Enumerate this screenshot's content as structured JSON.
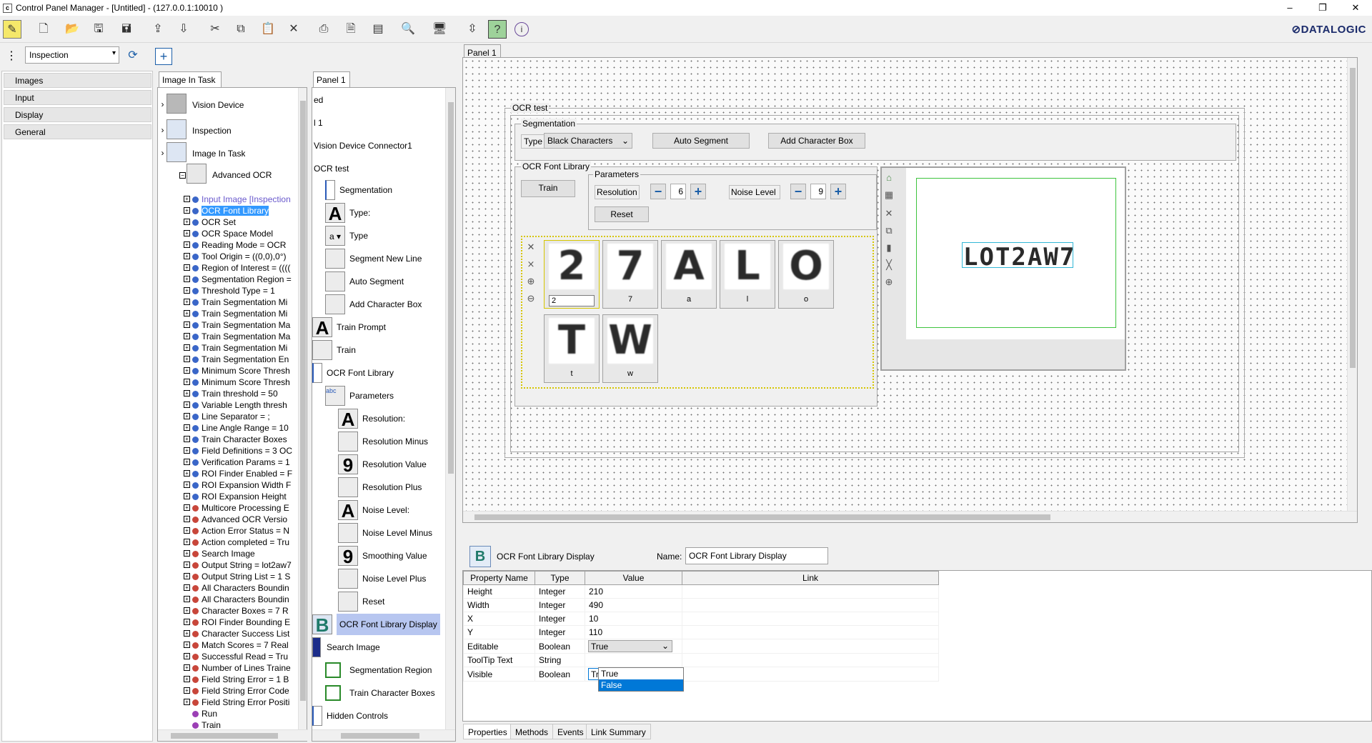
{
  "window": {
    "title": "Control Panel Manager - [Untitled] - (127.0.0.1:10010 )",
    "app_icon": "c",
    "min": "–",
    "max": "❐",
    "close": "✕"
  },
  "brand": {
    "logo": "⊘DATALOGIC"
  },
  "toolbar": {
    "inspection_value": "Inspection"
  },
  "nav": {
    "items": [
      "Images",
      "Input",
      "Display",
      "General"
    ]
  },
  "tree_panel": {
    "tab": "Image In Task",
    "top_items": [
      "Vision Device",
      "Inspection",
      "Image In Task",
      "Advanced OCR"
    ],
    "sub_items": [
      {
        "label": "Input Image [Inspection",
        "color": "#3a66c8",
        "text_color": "#6a5acd"
      },
      {
        "label": "OCR Font Library",
        "color": "#3a66c8",
        "selected": true
      },
      {
        "label": "OCR Set",
        "color": "#3a66c8"
      },
      {
        "label": "OCR Space Model",
        "color": "#3a66c8"
      },
      {
        "label": "Reading Mode = OCR",
        "color": "#3a66c8"
      },
      {
        "label": "Tool Origin = ((0,0),0°)",
        "color": "#3a66c8"
      },
      {
        "label": "Region of Interest = ((((",
        "color": "#3a66c8"
      },
      {
        "label": "Segmentation Region =",
        "color": "#3a66c8"
      },
      {
        "label": "Threshold Type = 1",
        "color": "#3a66c8"
      },
      {
        "label": "Train Segmentation Mi",
        "color": "#3a66c8"
      },
      {
        "label": "Train Segmentation Mi",
        "color": "#3a66c8"
      },
      {
        "label": "Train Segmentation Ma",
        "color": "#3a66c8"
      },
      {
        "label": "Train Segmentation Ma",
        "color": "#3a66c8"
      },
      {
        "label": "Train Segmentation Mi",
        "color": "#3a66c8"
      },
      {
        "label": "Train Segmentation En",
        "color": "#3a66c8"
      },
      {
        "label": "Minimum Score Thresh",
        "color": "#3a66c8"
      },
      {
        "label": "Minimum Score Thresh",
        "color": "#3a66c8"
      },
      {
        "label": "Train threshold = 50",
        "color": "#3a66c8"
      },
      {
        "label": "Variable Length thresh",
        "color": "#3a66c8"
      },
      {
        "label": "Line Separator = ;",
        "color": "#3a66c8"
      },
      {
        "label": "Line Angle Range = 10",
        "color": "#3a66c8"
      },
      {
        "label": "Train Character Boxes",
        "color": "#3a66c8"
      },
      {
        "label": "Field Definitions = 3 OC",
        "color": "#3a66c8"
      },
      {
        "label": "Verification Params = 1",
        "color": "#3a66c8"
      },
      {
        "label": "ROI Finder Enabled = F",
        "color": "#3a66c8"
      },
      {
        "label": "ROI Expansion Width F",
        "color": "#3a66c8"
      },
      {
        "label": "ROI Expansion Height",
        "color": "#3a66c8"
      },
      {
        "label": "Multicore Processing E",
        "color": "#c8463a"
      },
      {
        "label": "Advanced OCR Versio",
        "color": "#c8463a"
      },
      {
        "label": "Action Error Status = N",
        "color": "#c8463a"
      },
      {
        "label": "Action completed = Tru",
        "color": "#c8463a"
      },
      {
        "label": "Search Image",
        "color": "#c8463a"
      },
      {
        "label": "Output String = lot2aw7",
        "color": "#c8463a"
      },
      {
        "label": "Output String List = 1 S",
        "color": "#c8463a"
      },
      {
        "label": "All Characters Boundin",
        "color": "#c8463a"
      },
      {
        "label": "All Characters Boundin",
        "color": "#c8463a"
      },
      {
        "label": "Character Boxes = 7 R",
        "color": "#c8463a"
      },
      {
        "label": "ROI Finder Bounding E",
        "color": "#c8463a"
      },
      {
        "label": "Character Success List",
        "color": "#c8463a"
      },
      {
        "label": "Match Scores = 7 Real",
        "color": "#c8463a"
      },
      {
        "label": "Successful Read = Tru",
        "color": "#c8463a"
      },
      {
        "label": "Number of Lines Traine",
        "color": "#c8463a"
      },
      {
        "label": "Field String Error = 1 B",
        "color": "#c8463a"
      },
      {
        "label": "Field String Error Code",
        "color": "#c8463a"
      },
      {
        "label": "Field String Error Positi",
        "color": "#c8463a"
      },
      {
        "label": "Run",
        "color": "#9b3fb5",
        "noexp": true
      },
      {
        "label": "Train",
        "color": "#9b3fb5",
        "noexp": true
      }
    ]
  },
  "controls_panel": {
    "tab": "Panel 1",
    "items": [
      {
        "label": "ed",
        "indent": 0,
        "icon": ""
      },
      {
        "label": "l 1",
        "indent": 0,
        "icon": ""
      },
      {
        "label": "Vision Device Connector1",
        "indent": 0,
        "icon": ""
      },
      {
        "label": "OCR test",
        "indent": 0,
        "icon": ""
      },
      {
        "label": "Segmentation",
        "indent": 1,
        "icon": "frame"
      },
      {
        "label": "Type:",
        "indent": 1,
        "icon": "A"
      },
      {
        "label": "Type",
        "indent": 1,
        "icon": "a ▾"
      },
      {
        "label": "Segment New Line",
        "indent": 1,
        "icon": "btn"
      },
      {
        "label": "Auto Segment",
        "indent": 1,
        "icon": "btn"
      },
      {
        "label": "Add Character Box",
        "indent": 1,
        "icon": "btn"
      },
      {
        "label": "Train Prompt",
        "indent": 0,
        "icon": "A"
      },
      {
        "label": "Train",
        "indent": 0,
        "icon": "btn"
      },
      {
        "label": "OCR Font Library",
        "indent": 0,
        "icon": "frame"
      },
      {
        "label": "Parameters",
        "indent": 1,
        "icon": "abc"
      },
      {
        "label": "Resolution:",
        "indent": 2,
        "icon": "A"
      },
      {
        "label": "Resolution Minus",
        "indent": 2,
        "icon": "btn"
      },
      {
        "label": "Resolution Value",
        "indent": 2,
        "icon": "9"
      },
      {
        "label": "Resolution Plus",
        "indent": 2,
        "icon": "btn"
      },
      {
        "label": "Noise Level:",
        "indent": 2,
        "icon": "A"
      },
      {
        "label": "Noise Level Minus",
        "indent": 2,
        "icon": "btn"
      },
      {
        "label": "Smoothing Value",
        "indent": 2,
        "icon": "9"
      },
      {
        "label": "Noise Level Plus",
        "indent": 2,
        "icon": "btn"
      },
      {
        "label": "Reset",
        "indent": 2,
        "icon": "btn"
      },
      {
        "label": "OCR Font Library Display",
        "indent": 0,
        "icon": "B",
        "selected": true
      },
      {
        "label": "Search Image",
        "indent": 0,
        "icon": "img"
      },
      {
        "label": "Segmentation Region",
        "indent": 1,
        "icon": "roi"
      },
      {
        "label": "Train Character Boxes",
        "indent": 1,
        "icon": "roi"
      },
      {
        "label": "Hidden Controls",
        "indent": 0,
        "icon": "frame"
      }
    ]
  },
  "designer": {
    "tab": "Panel 1",
    "ocr_test": "OCR test",
    "segmentation": {
      "legend": "Segmentation",
      "type_label": "Type",
      "type_value": "Black Characters",
      "auto_segment": "Auto Segment",
      "add_char_box": "Add Character Box"
    },
    "font_library": {
      "legend": "OCR Font Library",
      "train": "Train",
      "parameters": "Parameters",
      "resolution": "Resolution",
      "resolution_value": "6",
      "noise": "Noise Level",
      "noise_value": "9",
      "reset": "Reset"
    },
    "glyphs": [
      {
        "img": "2",
        "label": "2",
        "editing": true
      },
      {
        "img": "7",
        "label": "7"
      },
      {
        "img": "A",
        "label": "a"
      },
      {
        "img": "L",
        "label": "l"
      },
      {
        "img": "O",
        "label": "o"
      },
      {
        "img": "T",
        "label": "t"
      },
      {
        "img": "W",
        "label": "w"
      }
    ],
    "read_string": "LOT2AW7"
  },
  "properties": {
    "control_name": "OCR Font Library Display",
    "name_label": "Name:",
    "name_value": "OCR Font Library Display",
    "headers": [
      "Property Name",
      "Type",
      "Value",
      "Link"
    ],
    "rows": [
      {
        "name": "Height",
        "type": "Integer",
        "value": "210"
      },
      {
        "name": "Width",
        "type": "Integer",
        "value": "490"
      },
      {
        "name": "X",
        "type": "Integer",
        "value": "10"
      },
      {
        "name": "Y",
        "type": "Integer",
        "value": "110"
      },
      {
        "name": "Editable",
        "type": "Boolean",
        "value": "True"
      },
      {
        "name": "ToolTip Text",
        "type": "String",
        "value": ""
      },
      {
        "name": "Visible",
        "type": "Boolean",
        "value": "True"
      }
    ],
    "dropdown_options": [
      "True",
      "False"
    ],
    "tabs": [
      "Properties",
      "Methods",
      "Events",
      "Link Summary"
    ]
  }
}
